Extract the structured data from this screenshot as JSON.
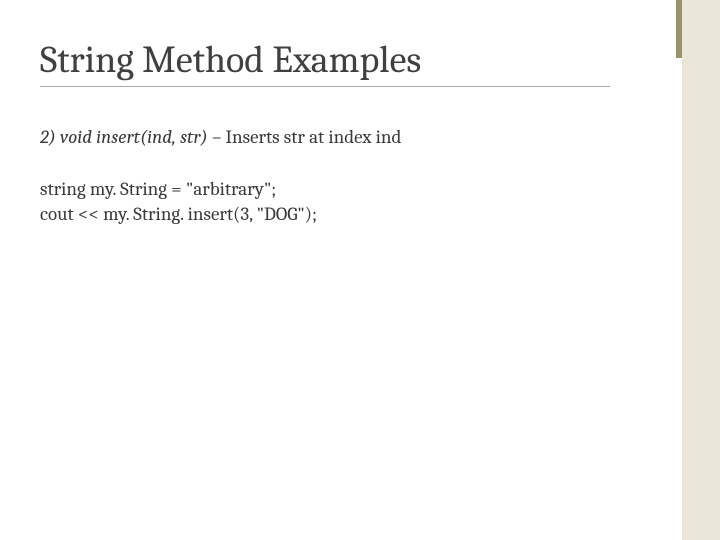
{
  "title": "String Method Examples",
  "desc_prefix_italic": "2) void insert(ind, str) –",
  "desc_rest": " Inserts str at index ind",
  "code_line_1": "string my. String = \"arbitrary\";",
  "code_line_2": "cout << my. String. insert(3, \"DOG\");"
}
